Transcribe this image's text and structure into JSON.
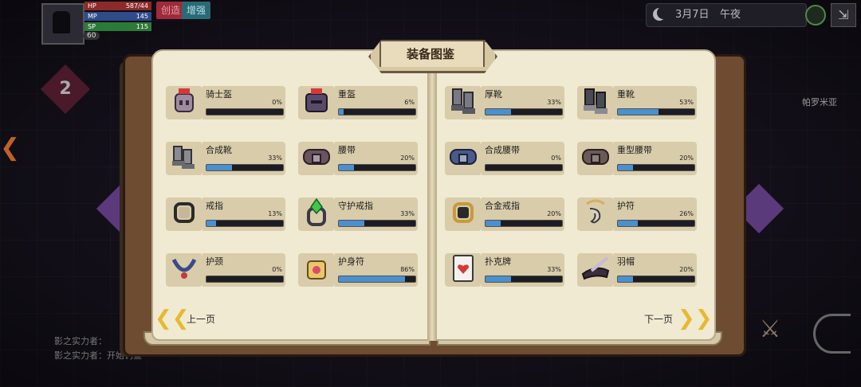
{
  "hud": {
    "hp_label": "HP",
    "hp_value": "587/44",
    "mp_label": "MP",
    "mp_value": "145",
    "sp_label": "SP",
    "sp_value": "115",
    "level": "60",
    "badge_red": "创造",
    "badge_teal": "增强",
    "date": "3月7日",
    "time": "午夜",
    "side_level": "2",
    "right_text": "帕罗米亚"
  },
  "messages": [
    "影之实力者：",
    "影之实力者：开始钓鱼"
  ],
  "book": {
    "title": "装备图鉴",
    "left_items": [
      {
        "name": "骑士盔",
        "percent": "0%",
        "progress": 0,
        "icon": "knight-helmet-icon"
      },
      {
        "name": "重盔",
        "percent": "6%",
        "progress": 6,
        "icon": "heavy-helmet-icon"
      },
      {
        "name": "合成靴",
        "percent": "33%",
        "progress": 33,
        "icon": "composite-boots-icon"
      },
      {
        "name": "腰带",
        "percent": "20%",
        "progress": 20,
        "icon": "belt-icon"
      },
      {
        "name": "戒指",
        "percent": "13%",
        "progress": 13,
        "icon": "ring-icon"
      },
      {
        "name": "守护戒指",
        "percent": "33%",
        "progress": 33,
        "icon": "guardian-ring-icon"
      },
      {
        "name": "护颈",
        "percent": "0%",
        "progress": 0,
        "icon": "neck-guard-icon"
      },
      {
        "name": "护身符",
        "percent": "86%",
        "progress": 86,
        "icon": "talisman-icon"
      }
    ],
    "right_items": [
      {
        "name": "厚靴",
        "percent": "33%",
        "progress": 33,
        "icon": "thick-boots-icon"
      },
      {
        "name": "重靴",
        "percent": "53%",
        "progress": 53,
        "icon": "heavy-boots-icon"
      },
      {
        "name": "合成腰带",
        "percent": "0%",
        "progress": 0,
        "icon": "composite-belt-icon"
      },
      {
        "name": "重型腰带",
        "percent": "20%",
        "progress": 20,
        "icon": "heavy-belt-icon"
      },
      {
        "name": "合金戒指",
        "percent": "20%",
        "progress": 20,
        "icon": "alloy-ring-icon"
      },
      {
        "name": "护符",
        "percent": "26%",
        "progress": 26,
        "icon": "amulet-icon"
      },
      {
        "name": "扑克牌",
        "percent": "33%",
        "progress": 33,
        "icon": "playing-card-icon"
      },
      {
        "name": "羽帽",
        "percent": "20%",
        "progress": 20,
        "icon": "feather-hat-icon"
      }
    ],
    "prev_label": "上一页",
    "next_label": "下一页"
  },
  "colors": {
    "progress_fill": "#4a90d0",
    "page": "#f0ead2",
    "card": "#d8ccaa"
  }
}
